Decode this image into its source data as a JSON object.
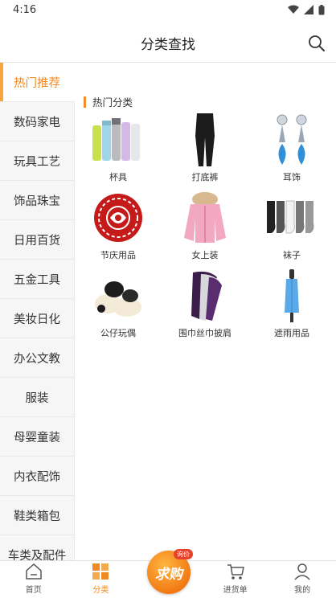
{
  "status_bar": {
    "time": "4:16"
  },
  "header": {
    "title": "分类查找"
  },
  "sidebar": {
    "items": [
      {
        "label": "热门推荐",
        "active": true
      },
      {
        "label": "数码家电"
      },
      {
        "label": "玩具工艺"
      },
      {
        "label": "饰品珠宝"
      },
      {
        "label": "日用百货"
      },
      {
        "label": "五金工具"
      },
      {
        "label": "美妆日化"
      },
      {
        "label": "办公文教"
      },
      {
        "label": "服装"
      },
      {
        "label": "母婴童装"
      },
      {
        "label": "内衣配饰"
      },
      {
        "label": "鞋类箱包"
      },
      {
        "label": "车类及配件"
      }
    ]
  },
  "main": {
    "section_title": "热门分类",
    "categories": [
      {
        "label": "杯具",
        "icon": "cups-icon"
      },
      {
        "label": "打底裤",
        "icon": "leggings-icon"
      },
      {
        "label": "耳饰",
        "icon": "earrings-icon"
      },
      {
        "label": "节庆用品",
        "icon": "papercut-icon"
      },
      {
        "label": "女上装",
        "icon": "jacket-icon"
      },
      {
        "label": "袜子",
        "icon": "socks-icon"
      },
      {
        "label": "公仔玩偶",
        "icon": "plush-icon"
      },
      {
        "label": "围巾丝巾披肩",
        "icon": "scarf-icon"
      },
      {
        "label": "遮雨用品",
        "icon": "umbrella-icon"
      }
    ]
  },
  "tabbar": {
    "items": [
      {
        "label": "首页",
        "icon": "home-icon"
      },
      {
        "label": "分类",
        "icon": "category-icon",
        "active": true
      },
      {
        "label": "进货单",
        "icon": "cart-icon"
      },
      {
        "label": "我的",
        "icon": "user-icon"
      }
    ],
    "promo_label": "求购",
    "promo_badge": "询价"
  },
  "colors": {
    "accent": "#f08a24",
    "sidebar_bg": "#f5f5f5"
  }
}
